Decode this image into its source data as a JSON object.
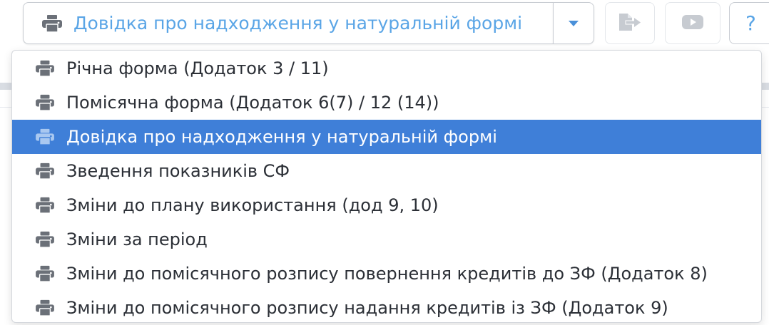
{
  "toolbar": {
    "report_button": {
      "label": "Довідка про надходження у натуральній формі",
      "icon": "printer-icon"
    },
    "toggle_icon": "caret-down-icon",
    "export_icon": "export-icon",
    "video_icon": "youtube-icon",
    "help": {
      "label": "?",
      "icon": "help-icon"
    }
  },
  "menu": {
    "items": [
      {
        "label": "Річна форма (Додаток 3 / 11)",
        "icon": "printer-icon",
        "selected": false
      },
      {
        "label": "Помісячна форма (Додаток 6(7) / 12 (14))",
        "icon": "printer-icon",
        "selected": false
      },
      {
        "label": "Довідка про надходження у натуральній формі",
        "icon": "printer-icon",
        "selected": true
      },
      {
        "label": "Зведення показників СФ",
        "icon": "printer-icon",
        "selected": false
      },
      {
        "label": "Зміни до плану використання (дод 9, 10)",
        "icon": "printer-icon",
        "selected": false
      },
      {
        "label": "Зміни за період",
        "icon": "printer-icon",
        "selected": false
      },
      {
        "label": "Зміни до помісячного розпису повернення кредитів до ЗФ (Додаток 8)",
        "icon": "printer-icon",
        "selected": false
      },
      {
        "label": "Зміни до помісячного розпису надання кредитів із ЗФ (Додаток 9)",
        "icon": "printer-icon",
        "selected": false
      }
    ]
  },
  "colors": {
    "accent": "#5aa5e6",
    "selected_bg": "#3f7fd8",
    "icon_gray": "#6b7078",
    "icon_disabled": "#c7cbd1"
  }
}
